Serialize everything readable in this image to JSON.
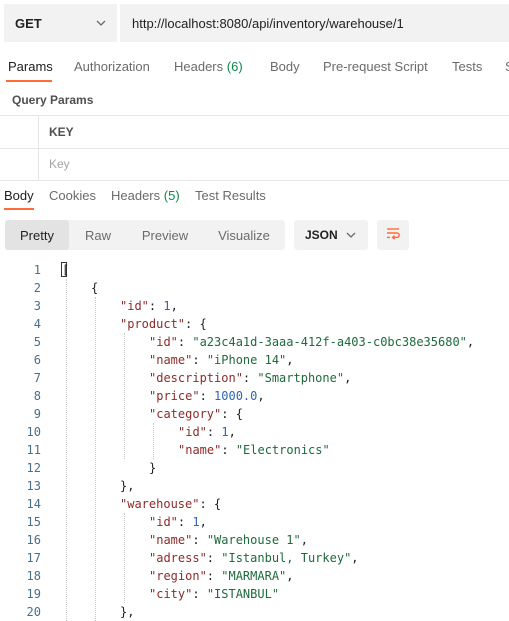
{
  "request": {
    "method": "GET",
    "url": "http://localhost:8080/api/inventory/warehouse/1"
  },
  "request_tabs": [
    {
      "label": "Params",
      "count": ""
    },
    {
      "label": "Authorization",
      "count": ""
    },
    {
      "label": "Headers",
      "count": "(6)"
    },
    {
      "label": "Body",
      "count": ""
    },
    {
      "label": "Pre-request Script",
      "count": ""
    },
    {
      "label": "Tests",
      "count": ""
    },
    {
      "label": "S",
      "count": ""
    }
  ],
  "query_params": {
    "title": "Query Params",
    "key_header": "KEY",
    "key_placeholder": "Key"
  },
  "response_tabs": [
    {
      "label": "Body",
      "count": ""
    },
    {
      "label": "Cookies",
      "count": ""
    },
    {
      "label": "Headers",
      "count": "(5)"
    },
    {
      "label": "Test Results",
      "count": ""
    }
  ],
  "view_modes": [
    "Pretty",
    "Raw",
    "Preview",
    "Visualize"
  ],
  "format": "JSON",
  "icons": {
    "method_dropdown": "chevron-down-icon",
    "format_dropdown": "chevron-down-icon",
    "wrap": "wrap-lines-icon"
  },
  "colors": {
    "accent": "#ff6c37",
    "count": "#0a8a4a",
    "json_key": "#8e2a2a",
    "json_string": "#1d6b3b",
    "json_number": "#2c66b1"
  },
  "code_lines": [
    {
      "n": "1",
      "indent": 0,
      "parts": [
        [
          "p",
          "["
        ]
      ]
    },
    {
      "n": "2",
      "indent": 1,
      "parts": [
        [
          "p",
          "{"
        ]
      ]
    },
    {
      "n": "3",
      "indent": 2,
      "parts": [
        [
          "k",
          "\"id\""
        ],
        [
          "p",
          ": "
        ],
        [
          "n",
          "1"
        ],
        [
          "p",
          ","
        ]
      ]
    },
    {
      "n": "4",
      "indent": 2,
      "parts": [
        [
          "k",
          "\"product\""
        ],
        [
          "p",
          ": {"
        ]
      ]
    },
    {
      "n": "5",
      "indent": 3,
      "parts": [
        [
          "k",
          "\"id\""
        ],
        [
          "p",
          ": "
        ],
        [
          "s",
          "\"a23c4a1d-3aaa-412f-a403-c0bc38e35680\""
        ],
        [
          "p",
          ","
        ]
      ]
    },
    {
      "n": "6",
      "indent": 3,
      "parts": [
        [
          "k",
          "\"name\""
        ],
        [
          "p",
          ": "
        ],
        [
          "s",
          "\"iPhone 14\""
        ],
        [
          "p",
          ","
        ]
      ]
    },
    {
      "n": "7",
      "indent": 3,
      "parts": [
        [
          "k",
          "\"description\""
        ],
        [
          "p",
          ": "
        ],
        [
          "s",
          "\"Smartphone\""
        ],
        [
          "p",
          ","
        ]
      ]
    },
    {
      "n": "8",
      "indent": 3,
      "parts": [
        [
          "k",
          "\"price\""
        ],
        [
          "p",
          ": "
        ],
        [
          "n",
          "1000.0"
        ],
        [
          "p",
          ","
        ]
      ]
    },
    {
      "n": "9",
      "indent": 3,
      "parts": [
        [
          "k",
          "\"category\""
        ],
        [
          "p",
          ": {"
        ]
      ]
    },
    {
      "n": "10",
      "indent": 4,
      "parts": [
        [
          "k",
          "\"id\""
        ],
        [
          "p",
          ": "
        ],
        [
          "n",
          "1"
        ],
        [
          "p",
          ","
        ]
      ]
    },
    {
      "n": "11",
      "indent": 4,
      "parts": [
        [
          "k",
          "\"name\""
        ],
        [
          "p",
          ": "
        ],
        [
          "s",
          "\"Electronics\""
        ]
      ]
    },
    {
      "n": "12",
      "indent": 3,
      "parts": [
        [
          "p",
          "}"
        ]
      ]
    },
    {
      "n": "13",
      "indent": 2,
      "parts": [
        [
          "p",
          "},"
        ]
      ]
    },
    {
      "n": "14",
      "indent": 2,
      "parts": [
        [
          "k",
          "\"warehouse\""
        ],
        [
          "p",
          ": {"
        ]
      ]
    },
    {
      "n": "15",
      "indent": 3,
      "parts": [
        [
          "k",
          "\"id\""
        ],
        [
          "p",
          ": "
        ],
        [
          "n",
          "1"
        ],
        [
          "p",
          ","
        ]
      ]
    },
    {
      "n": "16",
      "indent": 3,
      "parts": [
        [
          "k",
          "\"name\""
        ],
        [
          "p",
          ": "
        ],
        [
          "s",
          "\"Warehouse 1\""
        ],
        [
          "p",
          ","
        ]
      ]
    },
    {
      "n": "17",
      "indent": 3,
      "parts": [
        [
          "k",
          "\"adress\""
        ],
        [
          "p",
          ": "
        ],
        [
          "s",
          "\"Istanbul, Turkey\""
        ],
        [
          "p",
          ","
        ]
      ]
    },
    {
      "n": "18",
      "indent": 3,
      "parts": [
        [
          "k",
          "\"region\""
        ],
        [
          "p",
          ": "
        ],
        [
          "s",
          "\"MARMARA\""
        ],
        [
          "p",
          ","
        ]
      ]
    },
    {
      "n": "19",
      "indent": 3,
      "parts": [
        [
          "k",
          "\"city\""
        ],
        [
          "p",
          ": "
        ],
        [
          "s",
          "\"ISTANBUL\""
        ]
      ]
    },
    {
      "n": "20",
      "indent": 2,
      "parts": [
        [
          "p",
          "},"
        ]
      ]
    }
  ]
}
